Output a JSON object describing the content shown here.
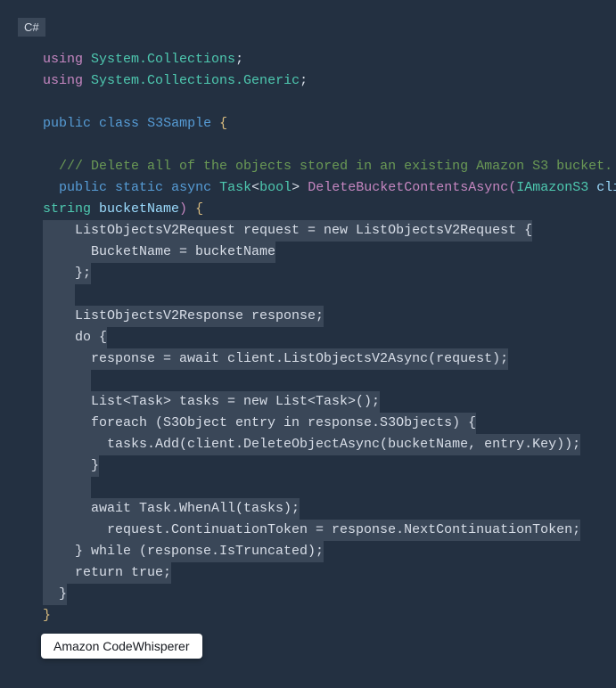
{
  "lang_badge": "C#",
  "code": {
    "l1_using": "using",
    "l1_ns": "System.Collections",
    "l2_using": "using",
    "l2_ns": "System.Collections.Generic",
    "l4_public": "public",
    "l4_class": "class",
    "l4_name": "S3Sample",
    "l6_comment": "/// Delete all of the objects stored in an existing Amazon S3 bucket.",
    "l7_public": "public",
    "l7_static": "static",
    "l7_async": "async",
    "l7_task": "Task",
    "l7_bool": "bool",
    "l7_method": "DeleteBucketContentsAsync",
    "l7_iface": "IAmazonS3",
    "l7_client": "client",
    "l8_string": "string",
    "l8_bucketName": "bucketName",
    "gen_l1": "    ListObjectsV2Request request = new ListObjectsV2Request {",
    "gen_l2": "      BucketName = bucketName",
    "gen_l3": "    };",
    "gen_l4": "    ",
    "gen_l5": "    ListObjectsV2Response response;",
    "gen_l6": "    do {",
    "gen_l7": "      response = await client.ListObjectsV2Async(request);",
    "gen_l8": "      ",
    "gen_l9": "      List<Task> tasks = new List<Task>();",
    "gen_l10": "      foreach (S3Object entry in response.S3Objects) {",
    "gen_l11": "        tasks.Add(client.DeleteObjectAsync(bucketName, entry.Key));",
    "gen_l12": "      }",
    "gen_l13": "      ",
    "gen_l14": "      await Task.WhenAll(tasks);",
    "gen_l15": "        request.ContinuationToken = response.NextContinuationToken;",
    "gen_l16": "    } while (response.IsTruncated);",
    "gen_l17": "    return true;",
    "gen_l18": "  }",
    "close_brace": "}"
  },
  "tooltip": "Amazon CodeWhisperer"
}
